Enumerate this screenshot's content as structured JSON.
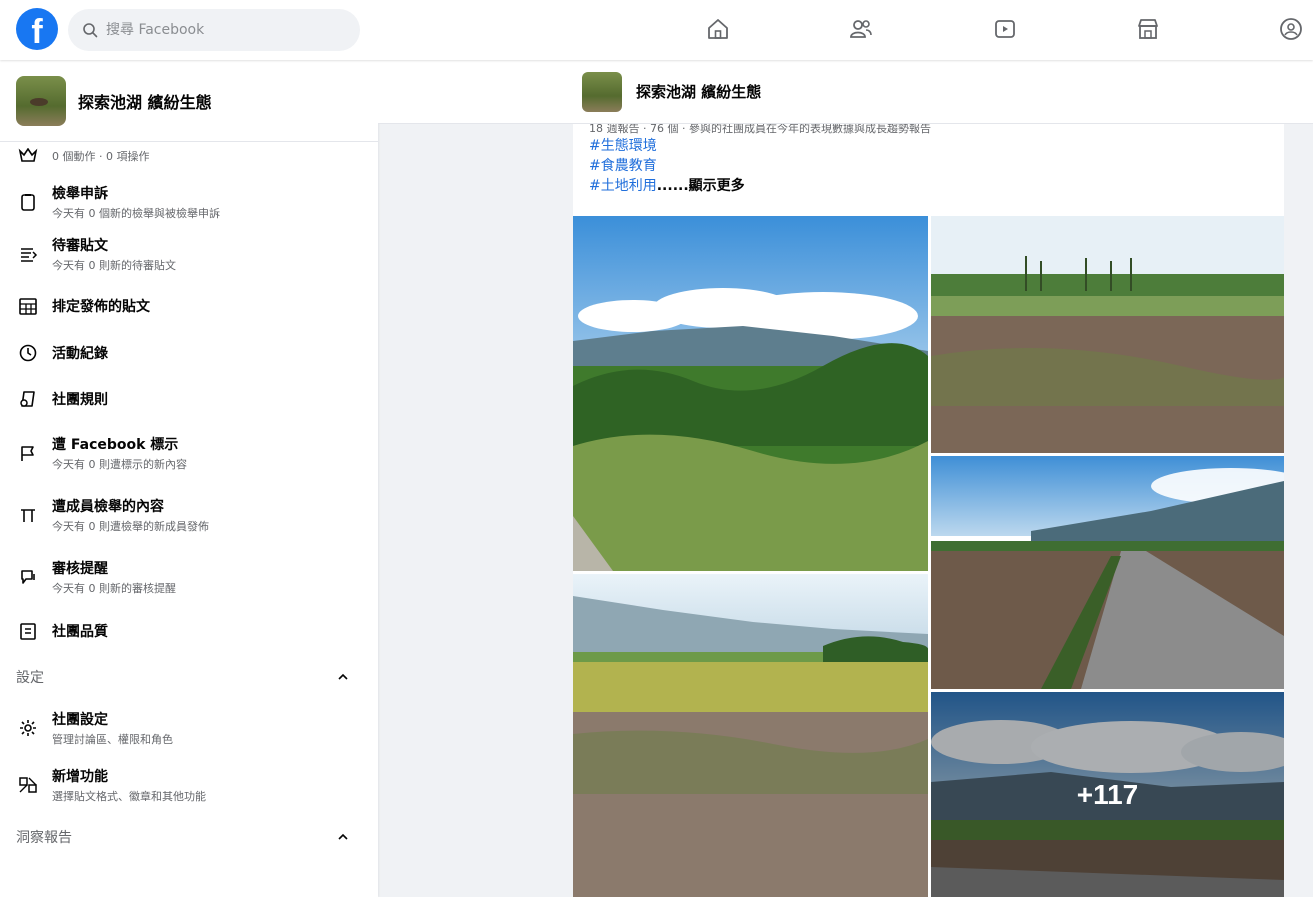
{
  "topbar": {
    "logo": "f",
    "search_placeholder": "搜尋 Facebook",
    "nav": [
      "home-icon",
      "friends-icon",
      "watch-icon",
      "marketplace-icon",
      "groups-icon"
    ]
  },
  "group": {
    "name": "探索池湖 繽紛生態"
  },
  "sidebar": {
    "top_partial": "0 個動作 · 0 項操作",
    "items": [
      {
        "title": "檢舉申訴",
        "subtitle": "今天有 0 個新的檢舉與被檢舉申訴",
        "icon": "report-icon"
      },
      {
        "title": "待審貼文",
        "subtitle": "今天有 0 則新的待審貼文",
        "icon": "pending-posts-icon"
      },
      {
        "title": "排定發佈的貼文",
        "subtitle": "",
        "icon": "calendar-icon"
      },
      {
        "title": "活動紀錄",
        "subtitle": "",
        "icon": "clock-icon"
      },
      {
        "title": "社團規則",
        "subtitle": "",
        "icon": "rules-icon"
      },
      {
        "title": "遭 Facebook 標示",
        "subtitle": "今天有 0 則遭標示的新內容",
        "icon": "flag-icon"
      },
      {
        "title": "遭成員檢舉的內容",
        "subtitle": "今天有 0 則遭檢舉的新成員發佈",
        "icon": "member-report-icon"
      },
      {
        "title": "審核提醒",
        "subtitle": "今天有 0 則新的審核提醒",
        "icon": "alert-icon"
      },
      {
        "title": "社團品質",
        "subtitle": "",
        "icon": "quality-icon"
      }
    ],
    "settings_section": "設定",
    "settings_items": [
      {
        "title": "社團設定",
        "subtitle": "管理討論區、權限和角色",
        "icon": "settings-icon"
      },
      {
        "title": "新增功能",
        "subtitle": "選擇貼文格式、徽章和其他功能",
        "icon": "features-icon"
      }
    ],
    "insights_section": "洞察報告"
  },
  "post": {
    "header_name": "探索池湖 繽紛生態",
    "cut_line": "18 週報告 · 76 個 · 參與的社團成員在今年的表現數據與成長趨勢報告",
    "tags": [
      "#生態環境",
      "#食農教育",
      "#土地利用"
    ],
    "see_more": "......顯示更多",
    "more_count": "+117"
  }
}
